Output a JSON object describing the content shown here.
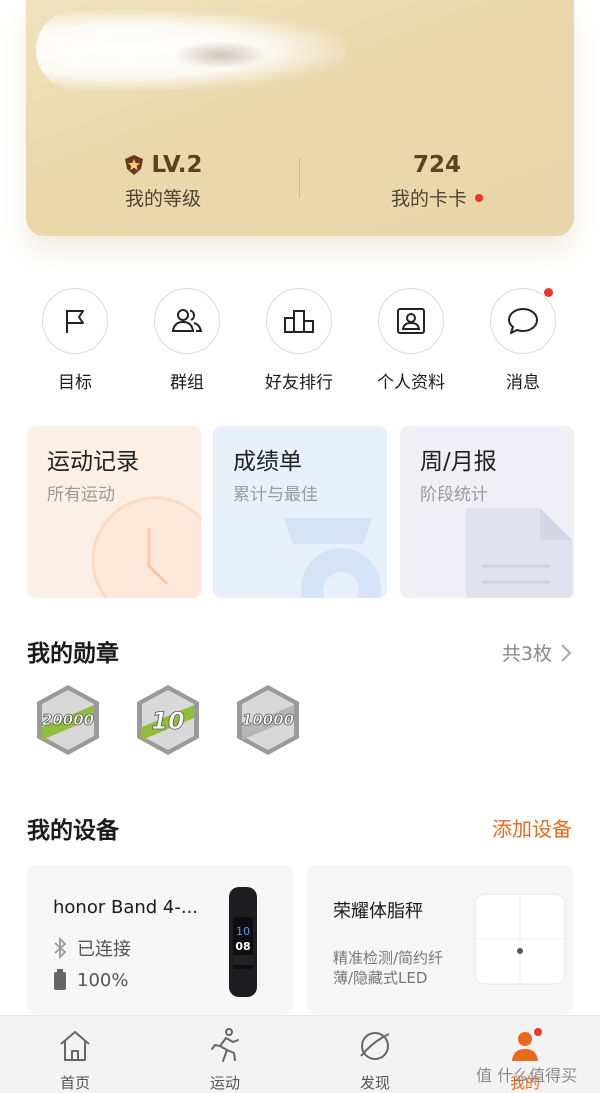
{
  "header": {
    "level_value": "LV.2",
    "level_label": "我的等级",
    "card_value": "724",
    "card_label": "我的卡卡"
  },
  "quick_actions": [
    {
      "label": "目标",
      "icon": "flag-icon"
    },
    {
      "label": "群组",
      "icon": "group-icon"
    },
    {
      "label": "好友排行",
      "icon": "ranking-icon"
    },
    {
      "label": "个人资料",
      "icon": "profile-card-icon"
    },
    {
      "label": "消息",
      "icon": "message-icon",
      "badge": true
    }
  ],
  "feature_cards": [
    {
      "title": "运动记录",
      "subtitle": "所有运动"
    },
    {
      "title": "成绩单",
      "subtitle": "累计与最佳"
    },
    {
      "title": "周/月报",
      "subtitle": "阶段统计"
    }
  ],
  "medals": {
    "title": "我的勋章",
    "count_label": "共3枚",
    "items": [
      {
        "label": "20000"
      },
      {
        "label": "10"
      },
      {
        "label": "10000"
      }
    ]
  },
  "devices": {
    "title": "我的设备",
    "add_label": "添加设备",
    "items": [
      {
        "name": "honor Band 4-...",
        "status": "已连接",
        "battery": "100%",
        "screen_top": "10",
        "screen_bottom": "08"
      },
      {
        "name": "荣耀体脂秤",
        "desc_line1": "精准检测/简约纤",
        "desc_line2": "薄/隐藏式LED"
      }
    ]
  },
  "bottom_nav": [
    {
      "label": "首页",
      "icon": "home-icon"
    },
    {
      "label": "运动",
      "icon": "running-icon"
    },
    {
      "label": "发现",
      "icon": "discover-icon"
    },
    {
      "label": "我的",
      "icon": "me-icon",
      "active": true
    }
  ],
  "watermark": "值 什么值得买",
  "colors": {
    "accent": "#e86a1e",
    "badge": "#e8382c",
    "header_gold": "#ead8ab"
  }
}
